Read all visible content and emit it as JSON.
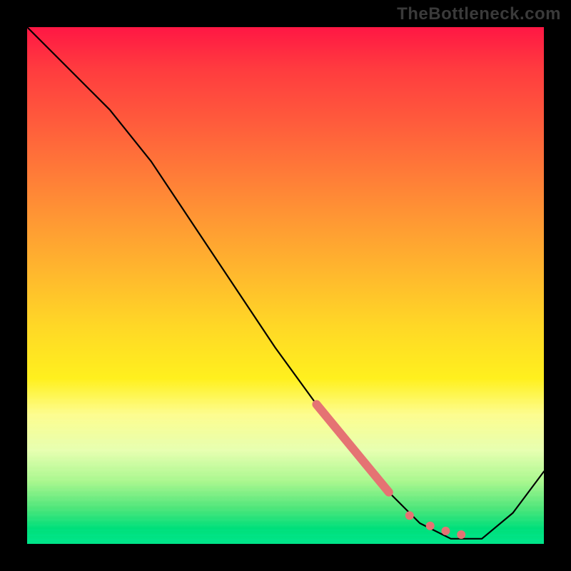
{
  "watermark": "TheBottleneck.com",
  "colors": {
    "curve": "#000000",
    "marker": "#e57373",
    "frame": "#000000"
  },
  "chart_data": {
    "type": "line",
    "title": "",
    "xlabel": "",
    "ylabel": "",
    "xlim": [
      0,
      100
    ],
    "ylim": [
      0,
      100
    ],
    "grid": false,
    "legend": false,
    "series": [
      {
        "name": "curve",
        "x": [
          0,
          8,
          16,
          24,
          32,
          40,
          48,
          56,
          63,
          70,
          76,
          82,
          88,
          94,
          100
        ],
        "y": [
          100,
          92,
          84,
          74,
          62,
          50,
          38,
          27,
          18,
          10,
          4,
          1,
          1,
          6,
          14
        ]
      }
    ],
    "highlight": {
      "name": "salmon-marker",
      "segment_x": [
        56,
        70
      ],
      "segment_y": [
        27,
        10
      ],
      "dots_x": [
        74,
        78,
        81,
        84
      ],
      "dots_y": [
        5.5,
        3.5,
        2.5,
        1.8
      ]
    }
  }
}
